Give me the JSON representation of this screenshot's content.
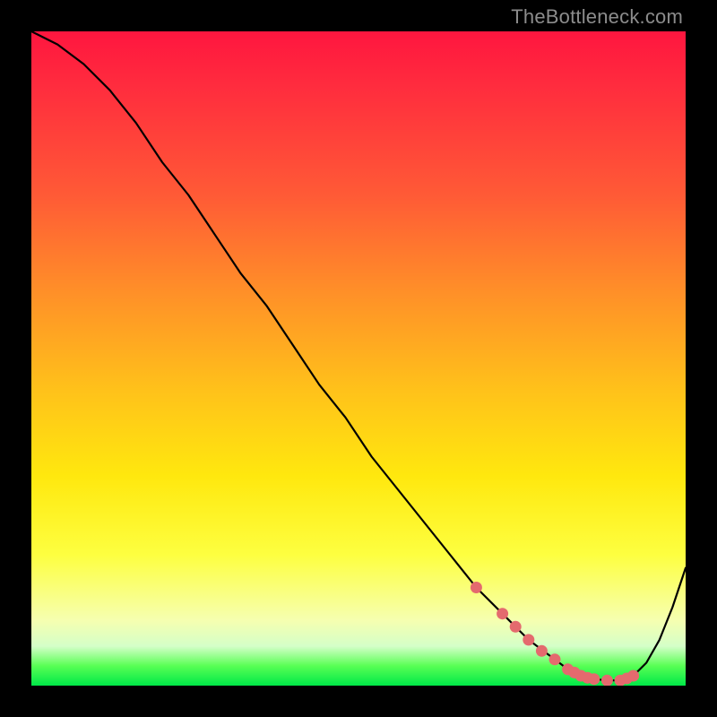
{
  "watermark": "TheBottleneck.com",
  "colors": {
    "marker": "#e46a6e",
    "curve": "#000000"
  },
  "chart_data": {
    "type": "line",
    "title": "",
    "xlabel": "",
    "ylabel": "",
    "xlim": [
      0,
      100
    ],
    "ylim": [
      0,
      100
    ],
    "grid": false,
    "series": [
      {
        "name": "bottleneck-curve",
        "x": [
          0,
          4,
          8,
          12,
          16,
          20,
          24,
          28,
          32,
          36,
          40,
          44,
          48,
          52,
          56,
          60,
          64,
          68,
          72,
          76,
          80,
          82,
          84,
          86,
          88,
          90,
          92,
          94,
          96,
          98,
          100
        ],
        "y": [
          100,
          98,
          95,
          91,
          86,
          80,
          75,
          69,
          63,
          58,
          52,
          46,
          41,
          35,
          30,
          25,
          20,
          15,
          11,
          7,
          4,
          2.5,
          1.5,
          1.0,
          0.8,
          0.8,
          1.5,
          3.5,
          7.0,
          12,
          18
        ]
      }
    ],
    "markers": {
      "name": "highlight-points",
      "x": [
        68,
        72,
        74,
        76,
        78,
        80,
        82,
        83,
        84,
        85,
        86,
        88,
        90,
        91,
        92
      ],
      "y": [
        15,
        11,
        9,
        7,
        5.3,
        4,
        2.5,
        2.0,
        1.5,
        1.2,
        1.0,
        0.8,
        0.8,
        1.1,
        1.5
      ]
    }
  }
}
